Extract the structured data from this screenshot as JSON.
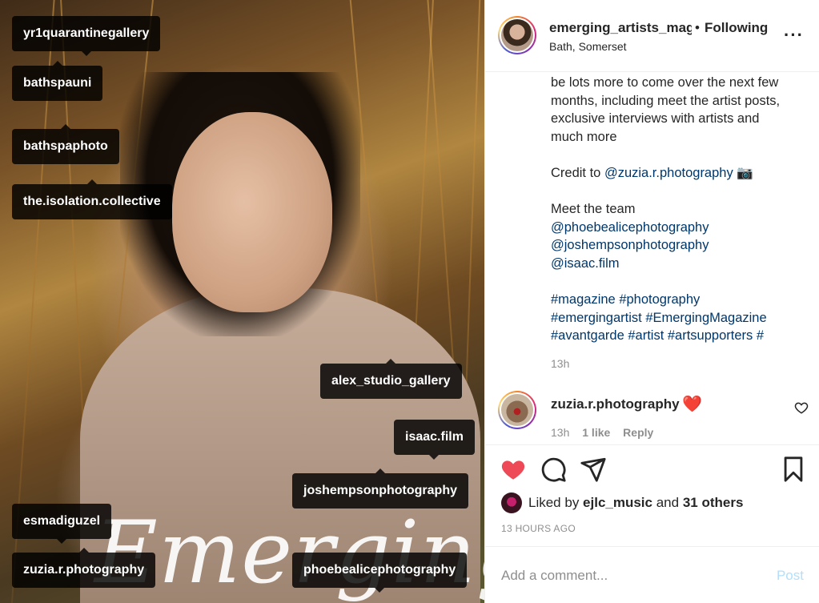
{
  "photo": {
    "masthead": "Emerging",
    "tags": [
      {
        "label": "yr1quarantinegallery"
      },
      {
        "label": "bathspauni"
      },
      {
        "label": "bathspaphoto"
      },
      {
        "label": "the.isolation.collective"
      },
      {
        "label": "alex_studio_gallery"
      },
      {
        "label": "isaac.film"
      },
      {
        "label": "joshempsonphotography"
      },
      {
        "label": "esmadiguzel"
      },
      {
        "label": "zuzia.r.photography"
      },
      {
        "label": "phoebealicephotography"
      }
    ]
  },
  "header": {
    "username": "emerging_artists_magazine",
    "separator": "•",
    "follow_label": "Following",
    "location": "Bath, Somerset",
    "more_label": "···"
  },
  "caption": {
    "lines_1": [
      "be lots more to come over the next few",
      "months, including meet the artist posts,",
      "exclusive interviews with artists and",
      "much more"
    ],
    "credit_prefix": "Credit to ",
    "credit_handle": "@zuzia.r.photography",
    "credit_emoji": "📷",
    "team_heading": "Meet the team",
    "team": [
      "@phoebealicephotography",
      "@joshempsonphotography",
      "@isaac.film"
    ],
    "hashtags_line1": [
      "#magazine",
      "#photography"
    ],
    "hashtags_line2": [
      "#emergingartist",
      "#EmergingMagazine"
    ],
    "hashtags_line3": [
      "#avantgarde",
      "#artist",
      "#artsupporters",
      "#"
    ],
    "time": "13h"
  },
  "comment": {
    "username": "zuzia.r.photography",
    "emoji": "❤️",
    "time": "13h",
    "likes": "1 like",
    "reply": "Reply"
  },
  "likes": {
    "prefix": "Liked by ",
    "user": "ejlc_music",
    "middle": " and ",
    "others": "31 others"
  },
  "posted": "13 HOURS AGO",
  "add_comment": {
    "placeholder": "Add a comment...",
    "post_label": "Post"
  },
  "colors": {
    "like_red": "#ed4956",
    "link_blue": "#00376b",
    "post_disabled": "#b2dffc"
  }
}
